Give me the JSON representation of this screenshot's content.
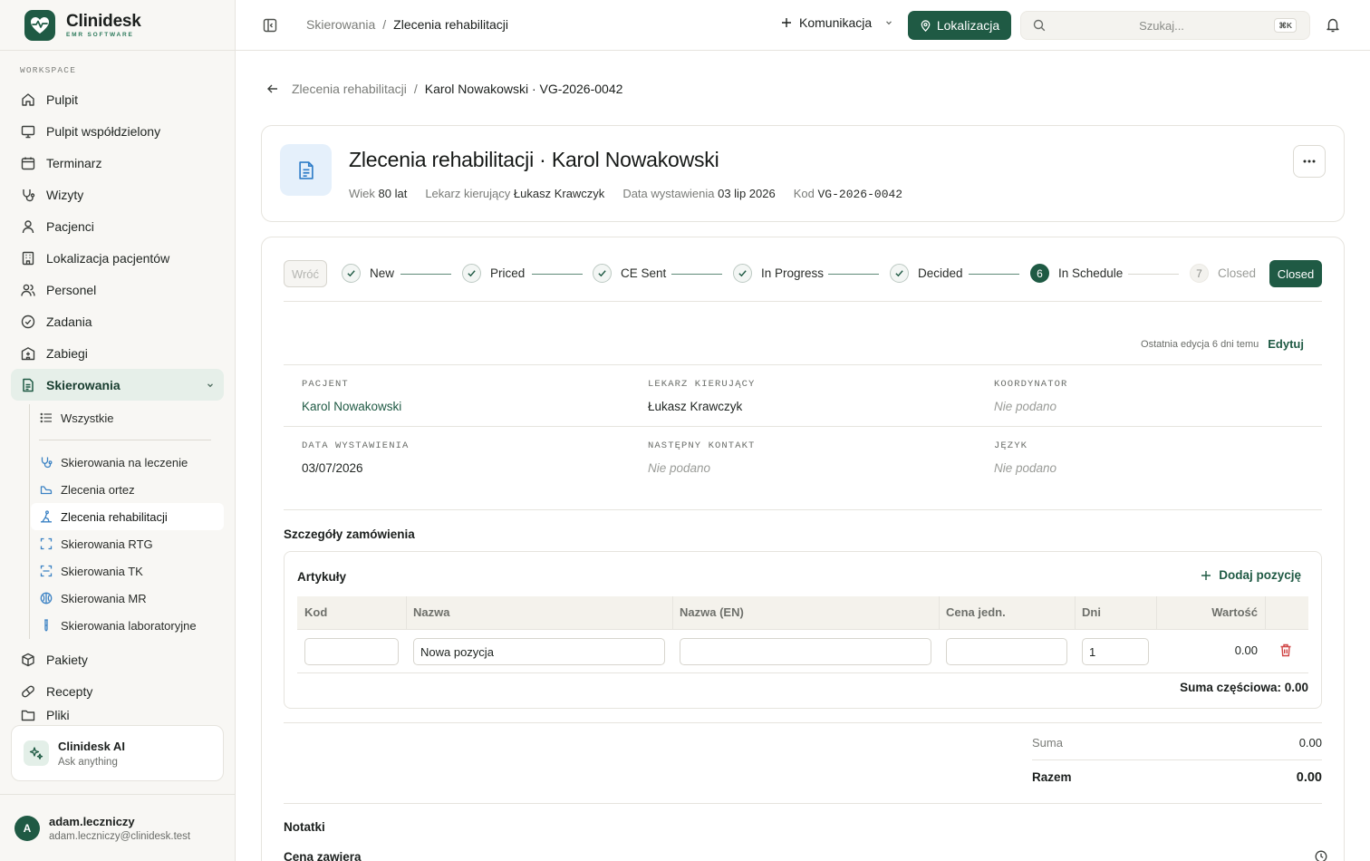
{
  "brand": {
    "name": "Clinidesk",
    "sub": "EMR SOFTWARE"
  },
  "sidebar": {
    "section_label": "WORKSPACE",
    "items": [
      {
        "label": "Pulpit",
        "icon": "home-icon"
      },
      {
        "label": "Pulpit współdzielony",
        "icon": "monitor-icon"
      },
      {
        "label": "Terminarz",
        "icon": "calendar-icon"
      },
      {
        "label": "Wizyty",
        "icon": "stethoscope-icon"
      },
      {
        "label": "Pacjenci",
        "icon": "user-icon"
      },
      {
        "label": "Lokalizacja pacjentów",
        "icon": "building-icon"
      },
      {
        "label": "Personel",
        "icon": "users-icon"
      },
      {
        "label": "Zadania",
        "icon": "check-circle-icon"
      },
      {
        "label": "Zabiegi",
        "icon": "hospital-icon"
      },
      {
        "label": "Skierowania",
        "icon": "document-icon"
      }
    ],
    "subitems": {
      "all": "Wszystkie",
      "list": [
        "Skierowania na leczenie",
        "Zlecenia ortez",
        "Zlecenia rehabilitacji",
        "Skierowania RTG",
        "Skierowania TK",
        "Skierowania MR",
        "Skierowania laboratoryjne"
      ]
    },
    "more": [
      {
        "label": "Pakiety",
        "icon": "package-icon"
      },
      {
        "label": "Recepty",
        "icon": "pill-icon"
      },
      {
        "label": "Pliki",
        "icon": "folder-icon"
      }
    ],
    "ai": {
      "title": "Clinidesk AI",
      "sub": "Ask anything"
    },
    "user": {
      "initial": "A",
      "name": "adam.leczniczy",
      "email": "adam.leczniczy@clinidesk.test"
    }
  },
  "topbar": {
    "crumb_parent": "Skierowania",
    "crumb_sep": "/",
    "crumb_current": "Zlecenia rehabilitacji",
    "komunikacja": "Komunikacja",
    "lokalizacja": "Lokalizacja",
    "search_placeholder": "Szukaj...",
    "shortcut": "⌘K"
  },
  "page": {
    "back_parent": "Zlecenia rehabilitacji",
    "back_sep": "/",
    "back_current": "Karol Nowakowski · VG-2026-0042",
    "title": "Zlecenia rehabilitacji · Karol Nowakowski",
    "meta": {
      "age_label": "Wiek",
      "age": "80 lat",
      "doctor_label": "Lekarz kierujący",
      "doctor": "Łukasz Krawczyk",
      "date_label": "Data wystawienia",
      "date": "03 lip 2026",
      "code_label": "Kod",
      "code": "VG-2026-0042"
    }
  },
  "workflow": {
    "back_label": "Wróć",
    "steps": [
      {
        "n": "1",
        "label": "New",
        "state": "done"
      },
      {
        "n": "2",
        "label": "Priced",
        "state": "done"
      },
      {
        "n": "3",
        "label": "CE Sent",
        "state": "done"
      },
      {
        "n": "4",
        "label": "In Progress",
        "state": "done"
      },
      {
        "n": "5",
        "label": "Decided",
        "state": "done"
      },
      {
        "n": "6",
        "label": "In Schedule",
        "state": "current"
      },
      {
        "n": "7",
        "label": "Closed",
        "state": "future"
      }
    ],
    "action_label": "Closed"
  },
  "details": {
    "last_edit": "Ostatnia edycja 6 dni temu",
    "edit_label": "Edytuj",
    "fields": {
      "patient": {
        "label": "PACJENT",
        "value": "Karol Nowakowski"
      },
      "doctor": {
        "label": "LEKARZ KIERUJĄCY",
        "value": "Łukasz Krawczyk"
      },
      "coordinator": {
        "label": "KOORDYNATOR",
        "value": "Nie podano"
      },
      "issued": {
        "label": "DATA WYSTAWIENIA",
        "value": "03/07/2026"
      },
      "next_contact": {
        "label": "NASTĘPNY KONTAKT",
        "value": "Nie podano"
      },
      "language": {
        "label": "JĘZYK",
        "value": "Nie podano"
      }
    }
  },
  "order": {
    "section_title": "Szczegóły zamówienia",
    "card_title": "Artykuły",
    "add_label": "Dodaj pozycję",
    "columns": [
      "Kod",
      "Nazwa",
      "Nazwa (EN)",
      "Cena jedn.",
      "Dni",
      "Wartość"
    ],
    "row": {
      "code": "",
      "name": "Nowa pozycja",
      "name_en": "",
      "unit_price": "",
      "days": "1",
      "value": "0.00"
    },
    "subtotal": "Suma częściowa: 0.00",
    "sum_label": "Suma",
    "sum_value": "0.00",
    "total_label": "Razem",
    "total_value": "0.00"
  },
  "notes": {
    "title": "Notatki",
    "sub": "Cena zawiera"
  }
}
